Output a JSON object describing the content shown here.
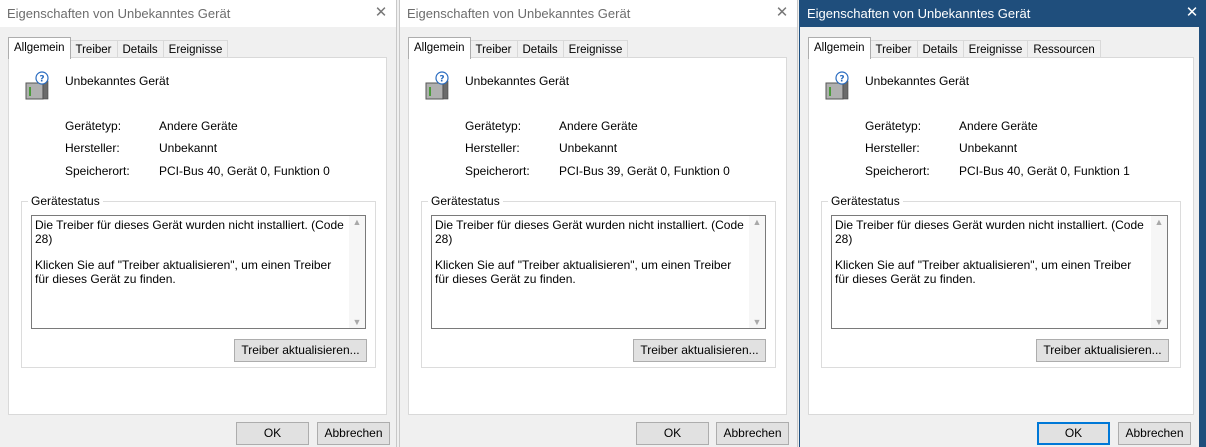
{
  "colors": {
    "active_titlebar": "#1f4e7c",
    "ok_focus": "#0078d7"
  },
  "windows": [
    {
      "title": "Eigenschaften von Unbekanntes Gerät",
      "tabs": [
        "Allgemein",
        "Treiber",
        "Details",
        "Ereignisse"
      ],
      "device_name": "Unbekanntes Gerät",
      "props": [
        {
          "label": "Gerätetyp:",
          "value": "Andere Geräte"
        },
        {
          "label": "Hersteller:",
          "value": "Unbekannt"
        },
        {
          "label": "Speicherort:",
          "value": "PCI-Bus 40, Gerät 0, Funktion 0"
        }
      ],
      "status_group": "Gerätestatus",
      "status_line1": "Die Treiber für dieses Gerät wurden nicht installiert. (Code 28)",
      "status_line2": "Klicken Sie auf \"Treiber aktualisieren\", um einen Treiber für dieses Gerät zu finden.",
      "update_button": "Treiber aktualisieren...",
      "ok": "OK",
      "cancel": "Abbrechen"
    },
    {
      "title": "Eigenschaften von Unbekanntes Gerät",
      "tabs": [
        "Allgemein",
        "Treiber",
        "Details",
        "Ereignisse"
      ],
      "device_name": "Unbekanntes Gerät",
      "props": [
        {
          "label": "Gerätetyp:",
          "value": "Andere Geräte"
        },
        {
          "label": "Hersteller:",
          "value": "Unbekannt"
        },
        {
          "label": "Speicherort:",
          "value": "PCI-Bus 39, Gerät 0, Funktion 0"
        }
      ],
      "status_group": "Gerätestatus",
      "status_line1": "Die Treiber für dieses Gerät wurden nicht installiert. (Code 28)",
      "status_line2": "Klicken Sie auf \"Treiber aktualisieren\", um einen Treiber für dieses Gerät zu finden.",
      "update_button": "Treiber aktualisieren...",
      "ok": "OK",
      "cancel": "Abbrechen"
    },
    {
      "title": "Eigenschaften von Unbekanntes Gerät",
      "tabs": [
        "Allgemein",
        "Treiber",
        "Details",
        "Ereignisse",
        "Ressourcen"
      ],
      "device_name": "Unbekanntes Gerät",
      "props": [
        {
          "label": "Gerätetyp:",
          "value": "Andere Geräte"
        },
        {
          "label": "Hersteller:",
          "value": "Unbekannt"
        },
        {
          "label": "Speicherort:",
          "value": "PCI-Bus 40, Gerät 0, Funktion 1"
        }
      ],
      "status_group": "Gerätestatus",
      "status_line1": "Die Treiber für dieses Gerät wurden nicht installiert. (Code 28)",
      "status_line2": "Klicken Sie auf \"Treiber aktualisieren\", um einen Treiber für dieses Gerät zu finden.",
      "update_button": "Treiber aktualisieren...",
      "ok": "OK",
      "cancel": "Abbrechen"
    }
  ]
}
